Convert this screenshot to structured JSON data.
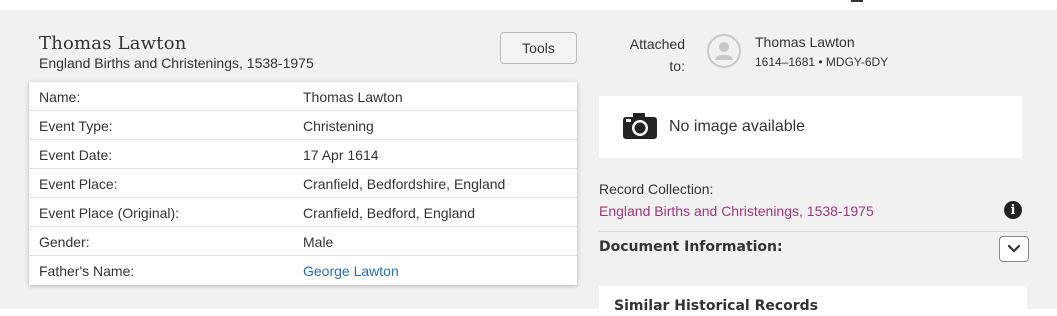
{
  "record": {
    "title": "Thomas Lawton",
    "subtitle": "England Births and Christenings, 1538-1975",
    "tools_label": "Tools"
  },
  "facts": [
    {
      "label": "Name:",
      "value": "Thomas Lawton"
    },
    {
      "label": "Event Type:",
      "value": "Christening"
    },
    {
      "label": "Event Date:",
      "value": "17 Apr 1614"
    },
    {
      "label": "Event Place:",
      "value": "Cranfield, Bedfordshire, England"
    },
    {
      "label": "Event Place (Original):",
      "value": "Cranfield, Bedford, England"
    },
    {
      "label": "Gender:",
      "value": "Male"
    },
    {
      "label": "Father's Name:",
      "value": "George Lawton"
    }
  ],
  "attached": {
    "label_line1": "Attached",
    "label_line2": "to:",
    "name": "Thomas Lawton",
    "meta": "1614–1681 • MDGY-6DY"
  },
  "image_panel": {
    "text": "No image available"
  },
  "collection": {
    "label": "Record Collection:",
    "link": "England Births and Christenings, 1538-1975"
  },
  "document_info": {
    "label": "Document Information:"
  },
  "similar": {
    "title": "Similar Historical Records"
  },
  "colors": {
    "link_blue": "#2a6eb8",
    "collection_link": "#a1377c",
    "page_bg": "#f1f1f1"
  }
}
